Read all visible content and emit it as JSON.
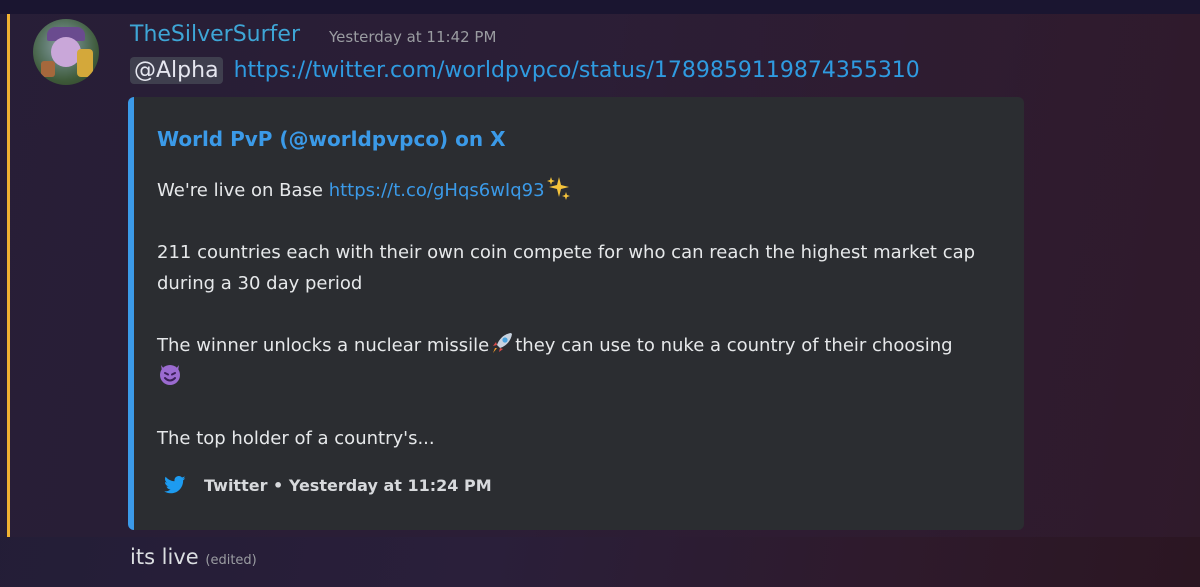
{
  "message": {
    "username": "TheSilverSurfer",
    "timestamp": "Yesterday at 11:42 PM",
    "mention": "@Alpha",
    "link": "https://twitter.com/worldpvpco/status/1789859119874355310",
    "accent_color": "#f0b232"
  },
  "embed": {
    "title": "World PvP (@worldpvpco) on X",
    "line1_text": "We're live on Base ",
    "line1_link": "https://t.co/gHqs6wIq93",
    "para2": "211 countries each with their own coin compete for who can reach the highest market cap during a 30 day period",
    "para3_a": "The winner unlocks a nuclear missile",
    "para3_b": "they can use to nuke a country of their choosing",
    "para4": "The top holder of a country's...",
    "footer": "Twitter • Yesterday at 11:24 PM",
    "border_color": "#3b9ae8",
    "icons": [
      "sparkles-emoji",
      "rocket-emoji",
      "smiling-devil-emoji",
      "twitter-bird-icon"
    ]
  },
  "next_message": {
    "text": "its live",
    "edited_label": "(edited)"
  }
}
